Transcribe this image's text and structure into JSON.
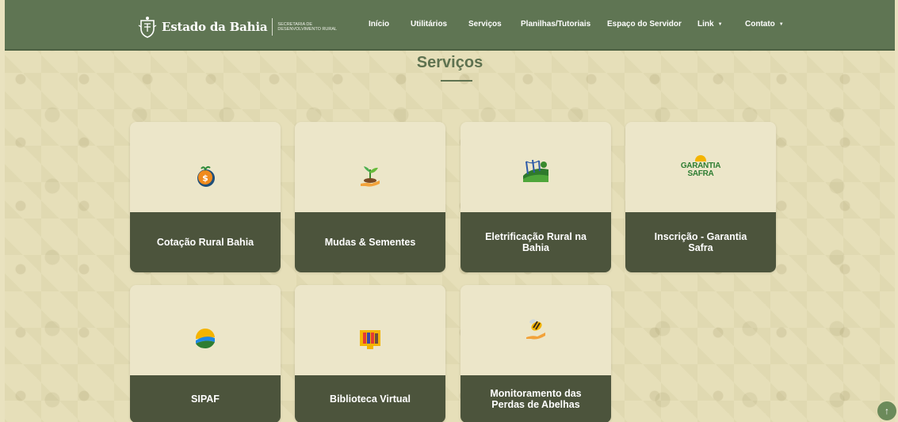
{
  "brand": {
    "name": "Estado da Bahia",
    "subtitle": "SECRETARIA DE DESENVOLVIMENTO RURAL"
  },
  "nav": {
    "items": [
      {
        "label": "Início"
      },
      {
        "label": "Utilitários"
      },
      {
        "label": "Serviços"
      },
      {
        "label": "Planilhas/Tutoriais"
      },
      {
        "label": "Espaço do Servidor"
      },
      {
        "label": "Link",
        "dropdown": true
      },
      {
        "label": "Contato",
        "dropdown": true
      }
    ]
  },
  "section": {
    "title": "Serviços"
  },
  "cards": [
    {
      "label": "Cotação Rural Bahia",
      "icon": "money-bag-icon"
    },
    {
      "label": "Mudas & Sementes",
      "icon": "seedling-hand-icon"
    },
    {
      "label": "Eletrificação Rural na Bahia",
      "icon": "rural-power-icon"
    },
    {
      "label": "Inscrição - Garantia Safra",
      "icon": "garantia-safra-logo",
      "logo_text": "GARANTIA SAFRA"
    },
    {
      "label": "SIPAF",
      "icon": "sipaf-logo-icon"
    },
    {
      "label": "Biblioteca Virtual",
      "icon": "library-books-icon"
    },
    {
      "label": "Monitoramento das Perdas de Abelhas",
      "icon": "bee-hand-icon"
    }
  ],
  "scroll_top": {
    "icon": "arrow-up-icon",
    "glyph": "↑"
  },
  "colors": {
    "navbar": "#5f7553",
    "card_bottom": "#4c543c",
    "card_top": "#ece6c9",
    "title": "#5e7250",
    "background": "#e6dfb9"
  }
}
